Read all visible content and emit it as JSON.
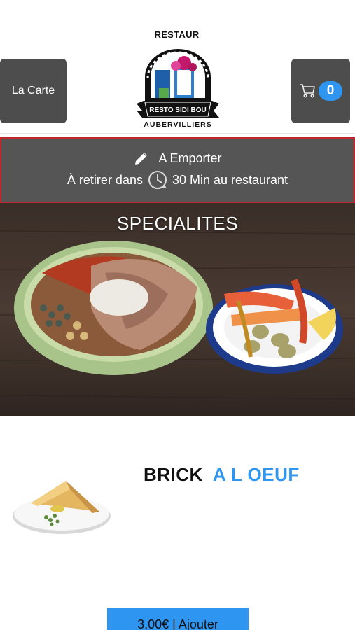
{
  "header": {
    "title": "RESTAUR",
    "menu_button_label": "La Carte",
    "cart_count": "0",
    "logo": {
      "name_text": "RESTO SIDI BOU",
      "city_text": "AUBERVILLIERS"
    }
  },
  "order_banner": {
    "mode_label": "A Emporter",
    "pickup_prefix": "À retirer dans",
    "pickup_suffix": "30 Min au restaurant"
  },
  "category": {
    "title": "SPECIALITES"
  },
  "product": {
    "name_part1": "BRICK",
    "name_part2": "A L OEUF",
    "add_button_label": "3,00€ | Ajouter"
  },
  "colors": {
    "accent_blue": "#2e95f0",
    "dark_button": "#4d4d4d",
    "banner_border": "#c0262c"
  }
}
